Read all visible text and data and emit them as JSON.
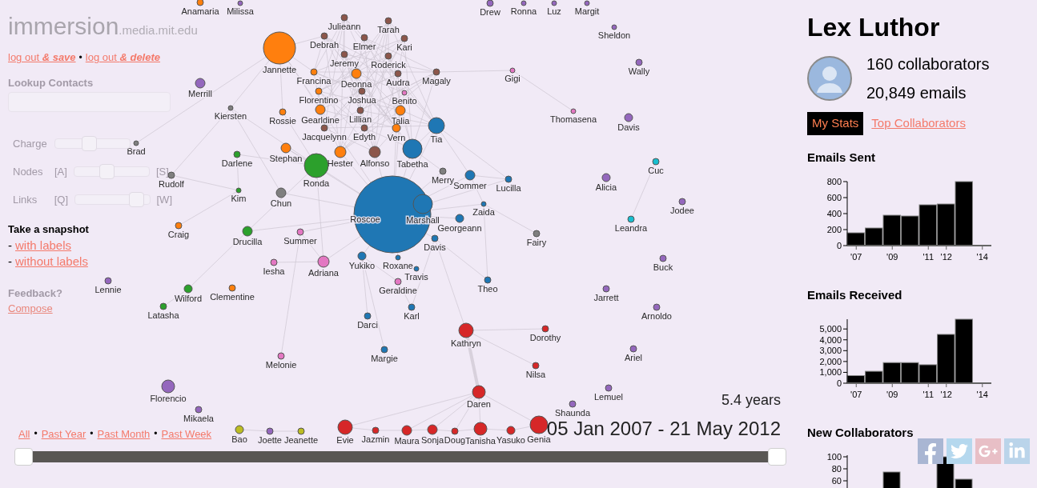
{
  "logo": {
    "name": "immersion",
    "domain": ".media.mit.edu"
  },
  "account_links": [
    {
      "kind": "link",
      "text": "log out *& save*"
    },
    {
      "kind": "separator",
      "text": "•"
    },
    {
      "kind": "link",
      "text": "log out *& delete*"
    }
  ],
  "lookup": {
    "label": "Lookup Contacts"
  },
  "sliders": [
    {
      "label": "Charge",
      "level": 0.45
    },
    {
      "label": "Nodes",
      "left_key": "[A]",
      "right_key": "[S]",
      "level": 0.42
    },
    {
      "label": "Links",
      "left_key": "[Q]",
      "right_key": "[W]",
      "level": 0.9
    }
  ],
  "snapshot": {
    "title": "Take a snapshot",
    "links": [
      {
        "dash": "-",
        "text": "with labels"
      },
      {
        "dash": "-",
        "text": "without labels"
      }
    ]
  },
  "feedback": {
    "title": "Feedback?",
    "link": "Compose"
  },
  "graph": {
    "nodes": [
      {
        "name": "Anamaria",
        "color": "#ff7f0e"
      },
      {
        "name": "Milissa",
        "color": "#9467bd"
      },
      {
        "name": "Drew",
        "color": "#9467bd"
      },
      {
        "name": "Ronna",
        "color": "#9467bd"
      },
      {
        "name": "Luz",
        "color": "#9467bd"
      },
      {
        "name": "Margit",
        "color": "#9467bd"
      },
      {
        "name": "Julieann",
        "color": "#8c564b"
      },
      {
        "name": "Tarah",
        "color": "#8c564b"
      },
      {
        "name": "Sheldon",
        "color": "#9467bd"
      },
      {
        "name": "Debrah",
        "color": "#8c564b"
      },
      {
        "name": "Elmer",
        "color": "#8c564b"
      },
      {
        "name": "Kari",
        "color": "#8c564b"
      },
      {
        "name": "Jannette",
        "color": "#ff7f0e"
      },
      {
        "name": "Jeremy",
        "color": "#8c564b"
      },
      {
        "name": "Roderick",
        "color": "#8c564b"
      },
      {
        "name": "Wally",
        "color": "#9467bd"
      },
      {
        "name": "Francina",
        "color": "#ff7f0e"
      },
      {
        "name": "Deonna",
        "color": "#ff7f0e"
      },
      {
        "name": "Audra",
        "color": "#8c564b"
      },
      {
        "name": "Magaly",
        "color": "#8c564b"
      },
      {
        "name": "Gigi",
        "color": "#e377c2"
      },
      {
        "name": "Merrill",
        "color": "#9467bd"
      },
      {
        "name": "Florentino",
        "color": "#ff7f0e"
      },
      {
        "name": "Joshua",
        "color": "#8c564b"
      },
      {
        "name": "Benito",
        "color": "#e377c2"
      },
      {
        "name": "Kiersten",
        "color": "#7f7f7f"
      },
      {
        "name": "Rossie",
        "color": "#ff7f0e"
      },
      {
        "name": "Gearldine",
        "color": "#ff7f0e"
      },
      {
        "name": "Lillian",
        "color": "#8c564b"
      },
      {
        "name": "Talia",
        "color": "#ff7f0e"
      },
      {
        "name": "Thomasena",
        "color": "#e377c2"
      },
      {
        "name": "Davis",
        "color": "#9467bd"
      },
      {
        "name": "Jacquelynn",
        "color": "#8c564b"
      },
      {
        "name": "Edyth",
        "color": "#8c564b"
      },
      {
        "name": "Vern",
        "color": "#ff7f0e"
      },
      {
        "name": "Tia",
        "color": "#1f77b4"
      },
      {
        "name": "Brad",
        "color": "#7f7f7f"
      },
      {
        "name": "Darlene",
        "color": "#2ca02c"
      },
      {
        "name": "Stephan",
        "color": "#ff7f0e"
      },
      {
        "name": "Hester",
        "color": "#ff7f0e"
      },
      {
        "name": "Alfonso",
        "color": "#8c564b"
      },
      {
        "name": "Tabetha",
        "color": "#1f77b4"
      },
      {
        "name": "Cuc",
        "color": "#17becf"
      },
      {
        "name": "Rudolf",
        "color": "#7f7f7f"
      },
      {
        "name": "Ronda",
        "color": "#2ca02c"
      },
      {
        "name": "Merry",
        "color": "#7f7f7f"
      },
      {
        "name": "Sommer",
        "color": "#1f77b4"
      },
      {
        "name": "Lucilla",
        "color": "#1f77b4"
      },
      {
        "name": "Alicia",
        "color": "#9467bd"
      },
      {
        "name": "Kim",
        "color": "#2ca02c"
      },
      {
        "name": "Chun",
        "color": "#7f7f7f"
      },
      {
        "name": "Roscoe",
        "color": "#1f77b4"
      },
      {
        "name": "Marshall",
        "color": "#1f77b4"
      },
      {
        "name": "Zaida",
        "color": "#1f77b4"
      },
      {
        "name": "Jodee",
        "color": "#9467bd"
      },
      {
        "name": "Craig",
        "color": "#ff7f0e"
      },
      {
        "name": "Georgeann",
        "color": "#1f77b4"
      },
      {
        "name": "Leandra",
        "color": "#17becf"
      },
      {
        "name": "Drucilla",
        "color": "#2ca02c"
      },
      {
        "name": "Summer",
        "color": "#e377c2"
      },
      {
        "name": "Davis",
        "color": "#1f77b4"
      },
      {
        "name": "Fairy",
        "color": "#7f7f7f"
      },
      {
        "name": "Iesha",
        "color": "#e377c2"
      },
      {
        "name": "Adriana",
        "color": "#e377c2"
      },
      {
        "name": "Yukiko",
        "color": "#1f77b4"
      },
      {
        "name": "Roxane",
        "color": "#1f77b4"
      },
      {
        "name": "Travis",
        "color": "#1f77b4"
      },
      {
        "name": "Buck",
        "color": "#9467bd"
      },
      {
        "name": "Lennie",
        "color": "#9467bd"
      },
      {
        "name": "Geraldine",
        "color": "#e377c2"
      },
      {
        "name": "Theo",
        "color": "#1f77b4"
      },
      {
        "name": "Wilford",
        "color": "#2ca02c"
      },
      {
        "name": "Clementine",
        "color": "#ff7f0e"
      },
      {
        "name": "Jarrett",
        "color": "#9467bd"
      },
      {
        "name": "Latasha",
        "color": "#2ca02c"
      },
      {
        "name": "Karl",
        "color": "#1f77b4"
      },
      {
        "name": "Arnoldo",
        "color": "#9467bd"
      },
      {
        "name": "Darci",
        "color": "#1f77b4"
      },
      {
        "name": "Kathryn",
        "color": "#d62728"
      },
      {
        "name": "Dorothy",
        "color": "#d62728"
      },
      {
        "name": "Melonie",
        "color": "#e377c2"
      },
      {
        "name": "Margie",
        "color": "#1f77b4"
      },
      {
        "name": "Ariel",
        "color": "#9467bd"
      },
      {
        "name": "Nilsa",
        "color": "#d62728"
      },
      {
        "name": "Florencio",
        "color": "#9467bd"
      },
      {
        "name": "Daren",
        "color": "#d62728"
      },
      {
        "name": "Lemuel",
        "color": "#9467bd"
      },
      {
        "name": "Mikaela",
        "color": "#9467bd"
      },
      {
        "name": "Shaunda",
        "color": "#9467bd"
      },
      {
        "name": "Bao",
        "color": "#bcbd22"
      },
      {
        "name": "Joette",
        "color": "#9467bd"
      },
      {
        "name": "Jeanette",
        "color": "#bcbd22"
      },
      {
        "name": "Evie",
        "color": "#d62728"
      },
      {
        "name": "Jazmin",
        "color": "#d62728"
      },
      {
        "name": "Maura",
        "color": "#d62728"
      },
      {
        "name": "Sonja",
        "color": "#d62728"
      },
      {
        "name": "Doug",
        "color": "#d62728"
      },
      {
        "name": "Tanisha",
        "color": "#d62728"
      },
      {
        "name": "Yasuko",
        "color": "#d62728"
      },
      {
        "name": "Genia",
        "color": "#d62728"
      }
    ]
  },
  "time_filters": [
    {
      "kind": "link",
      "text": "All"
    },
    {
      "kind": "separator",
      "text": "•"
    },
    {
      "kind": "link",
      "text": "Past Year"
    },
    {
      "kind": "separator",
      "text": "•"
    },
    {
      "kind": "link",
      "text": "Past Month"
    },
    {
      "kind": "separator",
      "text": "•"
    },
    {
      "kind": "link",
      "text": "Past Week"
    }
  ],
  "duration": "5.4 years",
  "date_range": "05 Jan 2007 - 21 May 2012",
  "range_slider": {
    "thumbs": [
      {
        "level": 0
      },
      {
        "level": 1
      }
    ]
  },
  "profile": {
    "name": "Lex Luthor",
    "collaborators": "160 collaborators",
    "emails": "20,849 emails"
  },
  "tabs": [
    {
      "label": "My Stats",
      "selected": true
    },
    {
      "label": "Top Collaborators",
      "selected": false
    }
  ],
  "charts": [
    {
      "kind": "chart",
      "title": "Emails Sent",
      "chart_data": {
        "type": "bar",
        "x": [
          2007,
          2008,
          2009,
          2010,
          2011,
          2012,
          2013
        ],
        "xlim": [
          2006.5,
          2014.5
        ],
        "ylim": [
          0,
          800
        ],
        "xticks": [
          {
            "value": 2007,
            "label": "'07"
          },
          {
            "value": 2009,
            "label": "'09"
          },
          {
            "value": 2011,
            "label": "'11"
          },
          {
            "value": 2012,
            "label": "'12"
          },
          {
            "value": 2014,
            "label": "'14"
          }
        ],
        "yticks": [
          {
            "value": 0,
            "label": "0"
          },
          {
            "value": 200,
            "label": "200"
          },
          {
            "value": 400,
            "label": "400"
          },
          {
            "value": 600,
            "label": "600"
          },
          {
            "value": 800,
            "label": "800"
          }
        ],
        "series": [
          {
            "color": "#000000",
            "values": [
              160,
              220,
              380,
              370,
              510,
              520,
              800
            ]
          }
        ]
      }
    },
    {
      "kind": "chart",
      "title": "Emails Received",
      "chart_data": {
        "type": "bar",
        "x": [
          2007,
          2008,
          2009,
          2010,
          2011,
          2012,
          2013
        ],
        "xlim": [
          2006.5,
          2014.5
        ],
        "ylim": [
          0,
          5900
        ],
        "xticks": [
          {
            "value": 2007,
            "label": "'07"
          },
          {
            "value": 2009,
            "label": "'09"
          },
          {
            "value": 2011,
            "label": "'11"
          },
          {
            "value": 2012,
            "label": "'12"
          },
          {
            "value": 2014,
            "label": "'14"
          }
        ],
        "yticks": [
          {
            "value": 0,
            "label": "0"
          },
          {
            "value": 1000,
            "label": "1,000"
          },
          {
            "value": 2000,
            "label": "2,000"
          },
          {
            "value": 3000,
            "label": "3,000"
          },
          {
            "value": 4000,
            "label": "4,000"
          },
          {
            "value": 5000,
            "label": "5,000"
          }
        ],
        "series": [
          {
            "color": "#000000",
            "values": [
              700,
              1100,
              1900,
              1900,
              1700,
              4500,
              5900
            ]
          }
        ]
      }
    },
    {
      "kind": "cut_chart",
      "title": "New Collaborators",
      "axis_labels": [
        "100",
        "80",
        "60"
      ]
    }
  ]
}
